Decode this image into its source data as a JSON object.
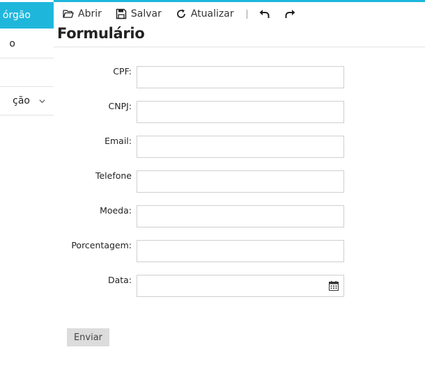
{
  "sidebar": {
    "header": "órgão",
    "items": [
      {
        "label": "o"
      },
      {
        "label": ""
      },
      {
        "label": "ção"
      }
    ]
  },
  "toolbar": {
    "open_label": "Abrir",
    "save_label": "Salvar",
    "refresh_label": "Atualizar"
  },
  "page": {
    "title": "Formulário"
  },
  "form": {
    "fields": [
      {
        "label": "CPF:",
        "value": ""
      },
      {
        "label": "CNPJ:",
        "value": ""
      },
      {
        "label": "Email:",
        "value": ""
      },
      {
        "label": "Telefone",
        "value": ""
      },
      {
        "label": "Moeda:",
        "value": ""
      },
      {
        "label": "Porcentagem:",
        "value": ""
      },
      {
        "label": "Data:",
        "value": ""
      }
    ],
    "submit_label": "Enviar"
  },
  "colors": {
    "accent": "#1fb6dc",
    "button_bg": "#dcdcdc",
    "border": "#cfcfcf"
  },
  "icons": [
    "folder-open-icon",
    "save-icon",
    "refresh-icon",
    "undo-icon",
    "redo-icon",
    "chevron-down-icon",
    "calendar-icon"
  ]
}
